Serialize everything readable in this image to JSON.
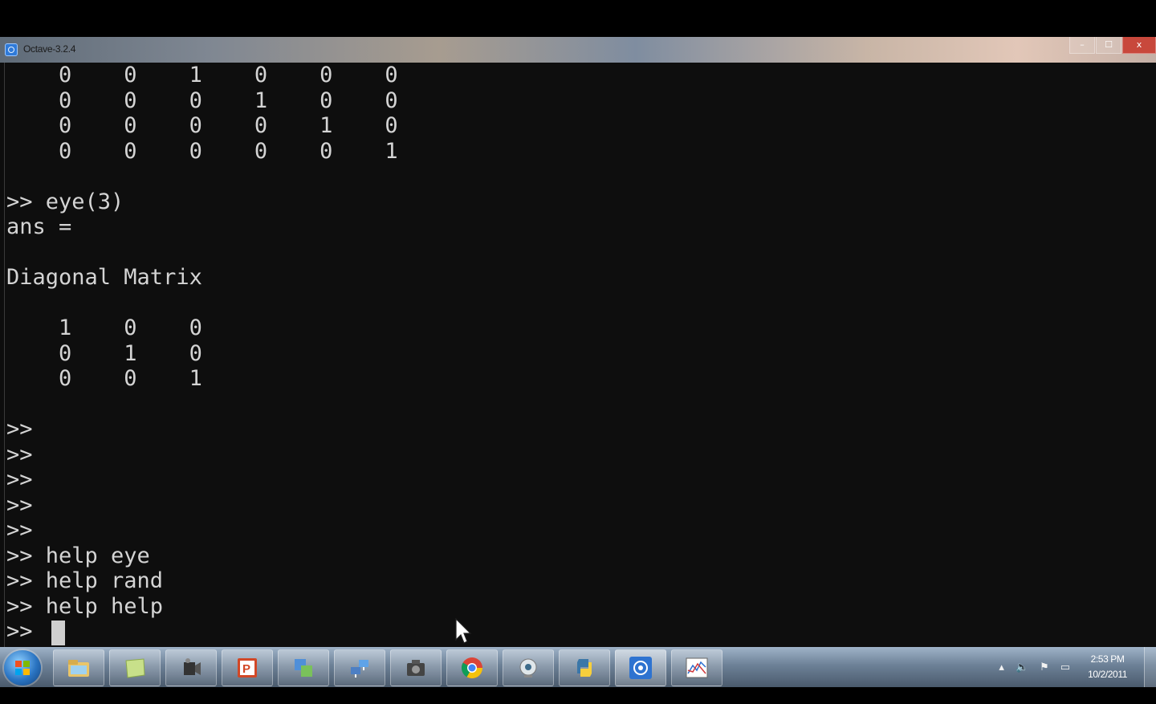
{
  "window": {
    "title": "Octave-3.2.4",
    "controls": {
      "minimize": "–",
      "maximize": "☐",
      "close": "x"
    }
  },
  "console": {
    "lines": [
      "    0    0    1    0    0    0",
      "    0    0    0    1    0    0",
      "    0    0    0    0    1    0",
      "    0    0    0    0    0    1",
      "",
      ">> eye(3)",
      "ans =",
      "",
      "Diagonal Matrix",
      "",
      "    1    0    0",
      "    0    1    0",
      "    0    0    1",
      "",
      ">>",
      ">>",
      ">>",
      ">>",
      ">>",
      ">> help eye",
      ">> help rand",
      ">> help help",
      ">> "
    ]
  },
  "taskbar": {
    "start_icon": "windows-orb-icon",
    "apps": [
      {
        "name": "explorer-icon",
        "active": false
      },
      {
        "name": "sticky-notes-icon",
        "active": false
      },
      {
        "name": "camtasia-recorder-icon",
        "active": false
      },
      {
        "name": "powerpoint-icon",
        "active": false
      },
      {
        "name": "snipping-tool-icon",
        "active": false
      },
      {
        "name": "network-icon",
        "active": false
      },
      {
        "name": "camera-icon",
        "active": false
      },
      {
        "name": "chrome-icon",
        "active": false
      },
      {
        "name": "webcam-icon",
        "active": false
      },
      {
        "name": "python-icon",
        "active": false
      },
      {
        "name": "octave-icon",
        "active": true
      },
      {
        "name": "plot-window-icon",
        "active": false
      }
    ],
    "clock": {
      "time": "2:53 PM",
      "date": "10/2/2011"
    }
  },
  "colors": {
    "console_bg": "#0e0e0e",
    "console_text": "#d4d4d4"
  }
}
